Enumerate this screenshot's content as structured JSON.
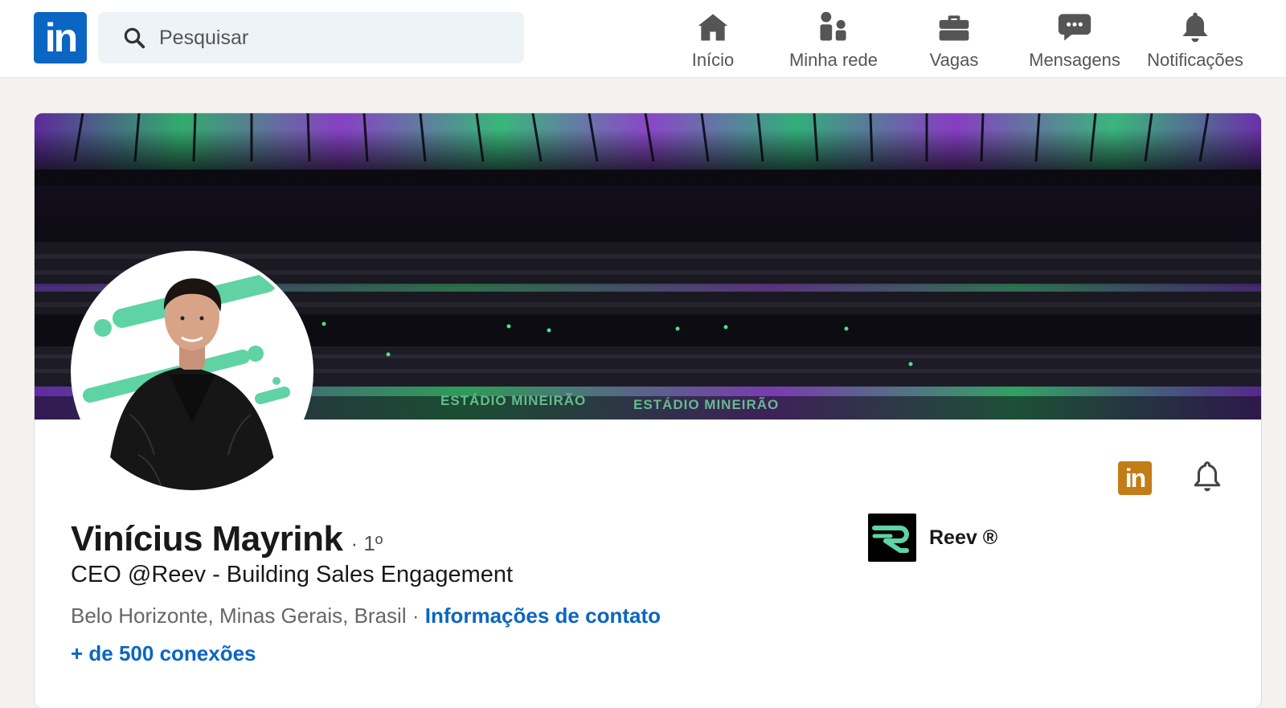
{
  "nav": {
    "logo_text": "in",
    "search_placeholder": "Pesquisar",
    "items": [
      {
        "label": "Início",
        "icon": "home-icon"
      },
      {
        "label": "Minha rede",
        "icon": "network-icon"
      },
      {
        "label": "Vagas",
        "icon": "briefcase-icon"
      },
      {
        "label": "Mensagens",
        "icon": "messages-icon"
      },
      {
        "label": "Notificações",
        "icon": "bell-icon"
      }
    ]
  },
  "profile": {
    "banner_text_1": "ESTÁDIO MINEIRÃO",
    "banner_text_2": "ESTÁDIO MINEIRÃO",
    "name": "Vinícius Mayrink",
    "degree": "· 1º",
    "headline": "CEO @Reev - Building Sales Engagement",
    "location": "Belo Horizonte, Minas Gerais, Brasil",
    "separator": " · ",
    "contact_info": "Informações de contato",
    "connections": "+ de 500 conexões",
    "company": {
      "name": "Reev ®",
      "logo_icon": "reev-logo"
    },
    "action_badge": "in"
  },
  "colors": {
    "brand_blue": "#0a66c2",
    "premium_gold": "#c37d16",
    "accent_green": "#5fd3a3"
  }
}
